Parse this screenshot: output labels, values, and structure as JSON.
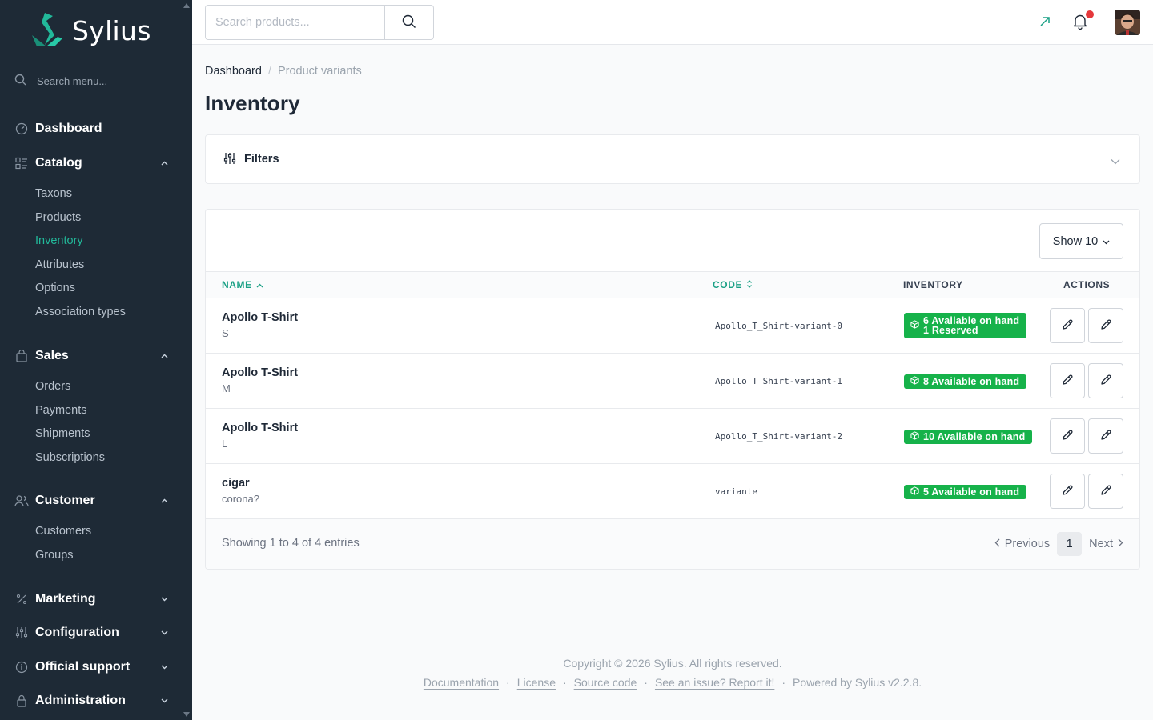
{
  "app": {
    "name": "Sylius"
  },
  "sidebar": {
    "search_placeholder": "Search menu...",
    "dashboard": "Dashboard",
    "catalog": {
      "label": "Catalog",
      "items": [
        "Taxons",
        "Products",
        "Inventory",
        "Attributes",
        "Options",
        "Association types"
      ],
      "active": "Inventory"
    },
    "sales": {
      "label": "Sales",
      "items": [
        "Orders",
        "Payments",
        "Shipments",
        "Subscriptions"
      ]
    },
    "customer": {
      "label": "Customer",
      "items": [
        "Customers",
        "Groups"
      ]
    },
    "marketing": "Marketing",
    "configuration": "Configuration",
    "official_support": "Official support",
    "administration": "Administration"
  },
  "topbar": {
    "search_placeholder": "Search products..."
  },
  "breadcrumb": {
    "home": "Dashboard",
    "current": "Product variants"
  },
  "page": {
    "title": "Inventory"
  },
  "filters": {
    "label": "Filters"
  },
  "table": {
    "show_label": "Show 10",
    "columns": {
      "name": "NAME",
      "code": "CODE",
      "inventory": "INVENTORY",
      "actions": "ACTIONS"
    },
    "rows": [
      {
        "name": "Apollo T-Shirt",
        "variant": "S",
        "code": "Apollo_T_Shirt-variant-0",
        "inventory_line1": "6 Available on hand",
        "inventory_line2": "1 Reserved"
      },
      {
        "name": "Apollo T-Shirt",
        "variant": "M",
        "code": "Apollo_T_Shirt-variant-1",
        "inventory_line1": "8 Available on hand"
      },
      {
        "name": "Apollo T-Shirt",
        "variant": "L",
        "code": "Apollo_T_Shirt-variant-2",
        "inventory_line1": "10 Available on hand"
      },
      {
        "name": "cigar",
        "variant": "corona?",
        "code": "variante",
        "inventory_line1": "5 Available on hand"
      }
    ],
    "entries": "Showing 1 to 4 of 4 entries",
    "pagination": {
      "previous": "Previous",
      "page": "1",
      "next": "Next"
    }
  },
  "footer": {
    "copyright_prefix": "Copyright © 2026",
    "copyright_link": "Sylius",
    "copyright_suffix": ". All rights reserved.",
    "links": [
      "Documentation",
      "License",
      "Source code",
      "See an issue? Report it!"
    ],
    "powered": "Powered by Sylius v2.2.8."
  },
  "colors": {
    "sidebar_bg": "#1e2a36",
    "accent": "#1aa085",
    "badge_green": "#16b24a",
    "notification": "#e5383b"
  },
  "icons": [
    "sylius-logo-icon",
    "search-icon",
    "dashboard-icon",
    "catalog-icon",
    "sales-bag-icon",
    "customer-icon",
    "marketing-percent-icon",
    "configuration-sliders-icon",
    "support-info-icon",
    "lock-icon",
    "external-link-icon",
    "bell-icon",
    "filter-sliders-icon",
    "chevron-down-icon",
    "box-icon",
    "pencil-icon"
  ]
}
